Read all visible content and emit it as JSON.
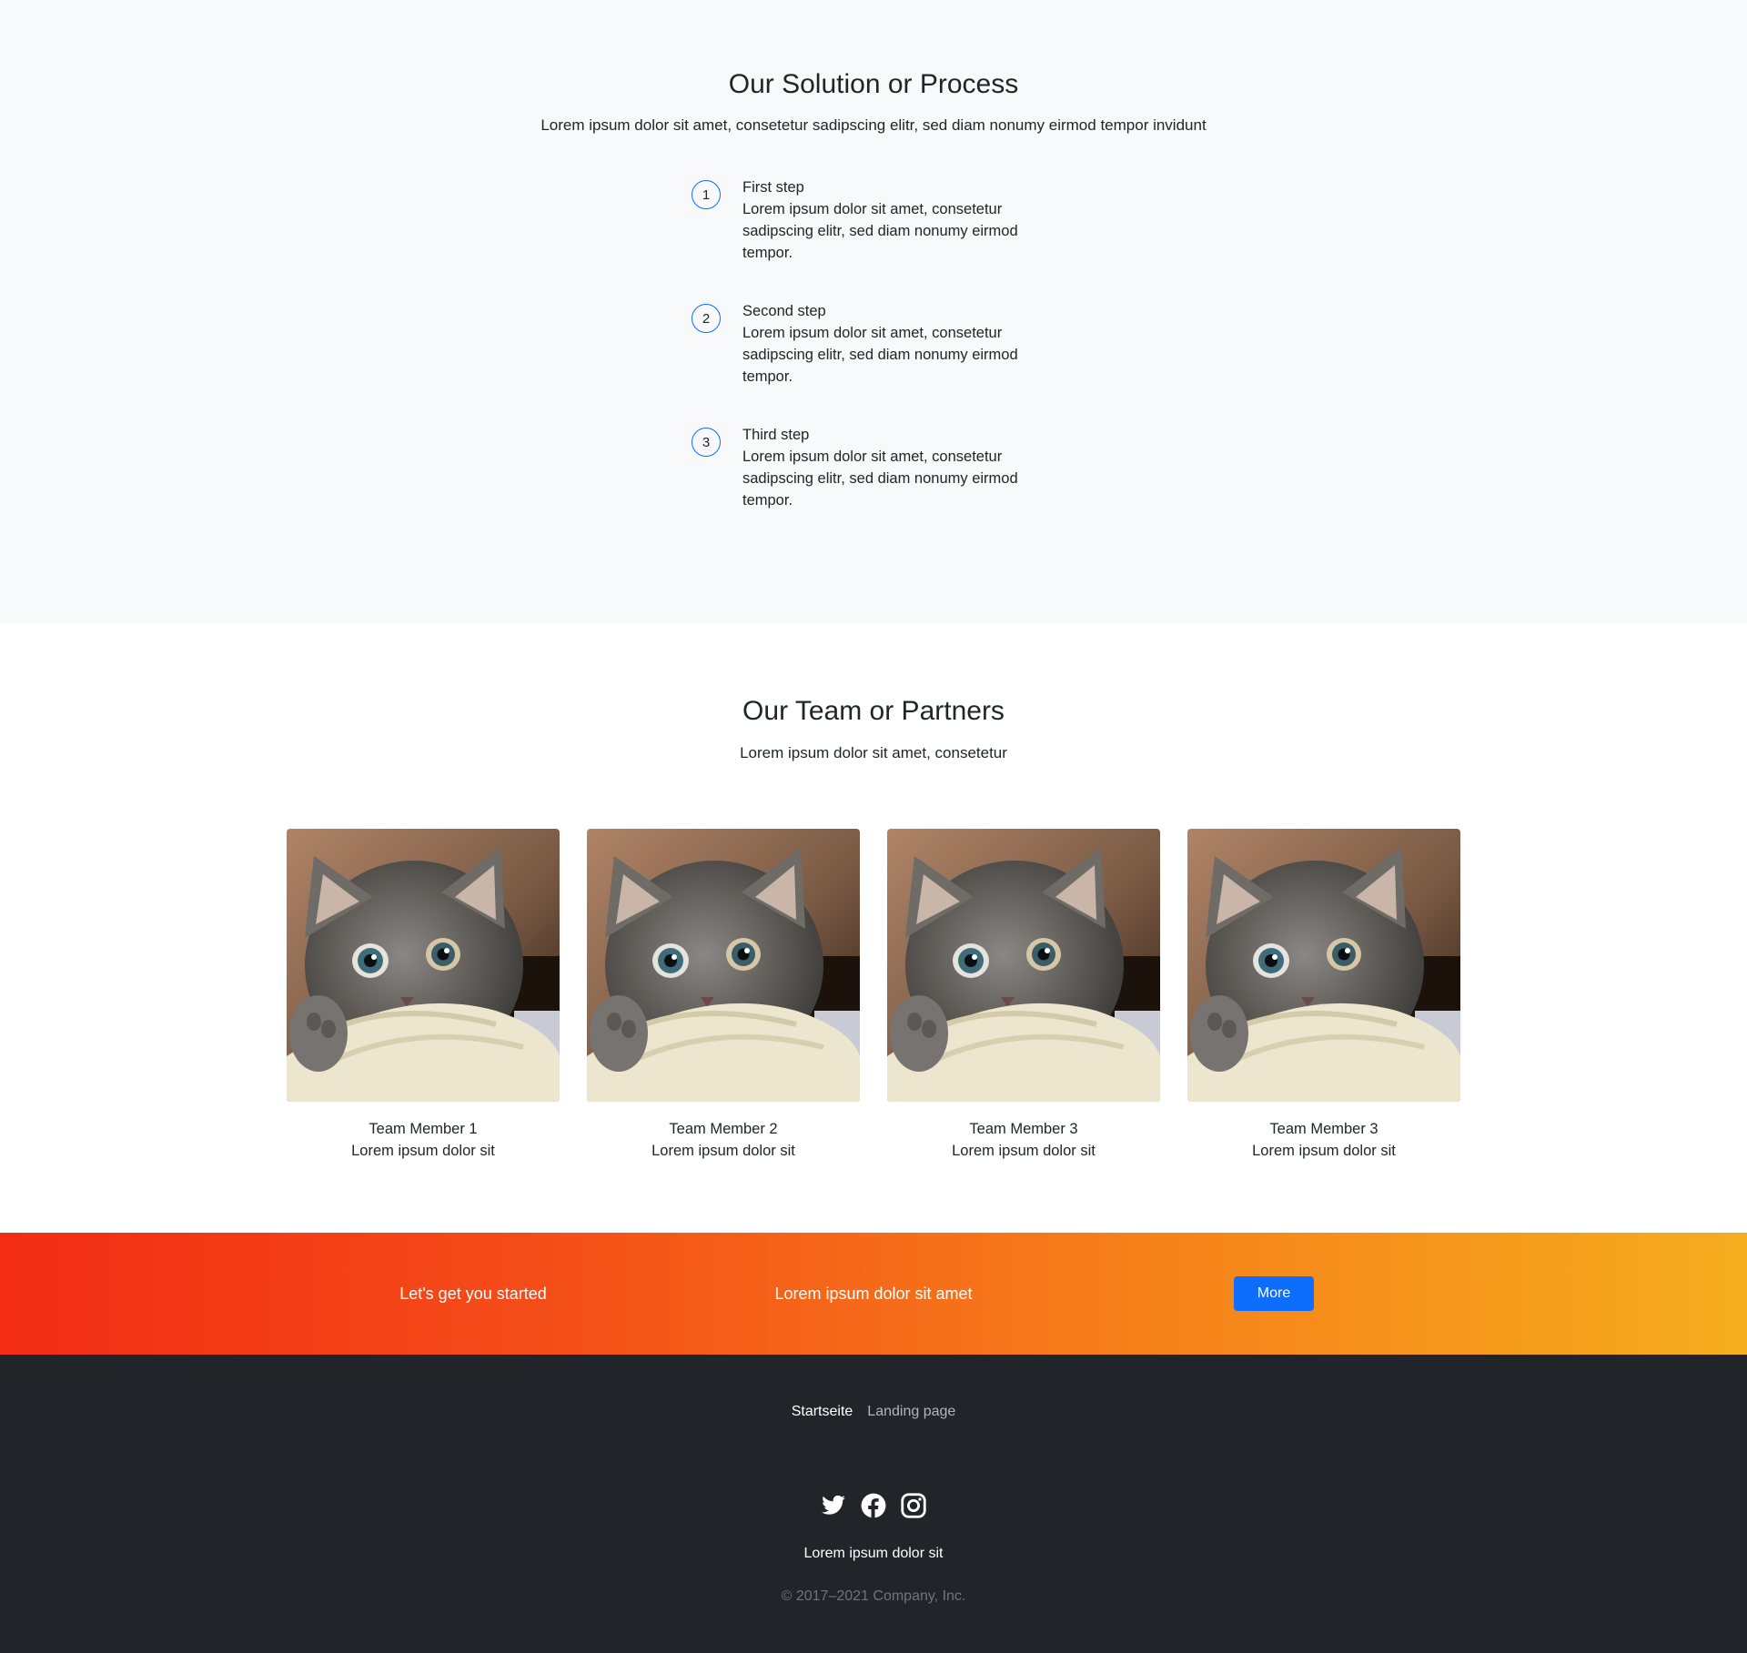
{
  "process": {
    "title": "Our Solution or Process",
    "subtitle": "Lorem ipsum dolor sit amet, consetetur sadipscing elitr, sed diam nonumy eirmod tempor invidunt",
    "steps": [
      {
        "number": "1",
        "title": "First step",
        "text": "Lorem ipsum dolor sit amet, consetetur sadipscing elitr, sed diam nonumy eirmod tempor."
      },
      {
        "number": "2",
        "title": "Second step",
        "text": "Lorem ipsum dolor sit amet, consetetur sadipscing elitr, sed diam nonumy eirmod tempor."
      },
      {
        "number": "3",
        "title": "Third step",
        "text": "Lorem ipsum dolor sit amet, consetetur sadipscing elitr, sed diam nonumy eirmod tempor."
      }
    ]
  },
  "team": {
    "title": "Our Team or Partners",
    "subtitle": "Lorem ipsum dolor sit amet, consetetur",
    "members": [
      {
        "name": "Team Member 1",
        "role": "Lorem ipsum dolor sit"
      },
      {
        "name": "Team Member 2",
        "role": "Lorem ipsum dolor sit"
      },
      {
        "name": "Team Member 3",
        "role": "Lorem ipsum dolor sit"
      },
      {
        "name": "Team Member 3",
        "role": "Lorem ipsum dolor sit"
      }
    ]
  },
  "cta": {
    "heading": "Let's get you started",
    "text": "Lorem ipsum dolor sit amet",
    "button_label": "More",
    "button_color": "#0d6efd"
  },
  "footer": {
    "nav": [
      "Startseite",
      "Landing page"
    ],
    "social_icons": [
      "twitter-icon",
      "facebook-icon",
      "instagram-icon"
    ],
    "tagline": "Lorem ipsum dolor sit",
    "copyright": "© 2017–2021 Company, Inc."
  }
}
